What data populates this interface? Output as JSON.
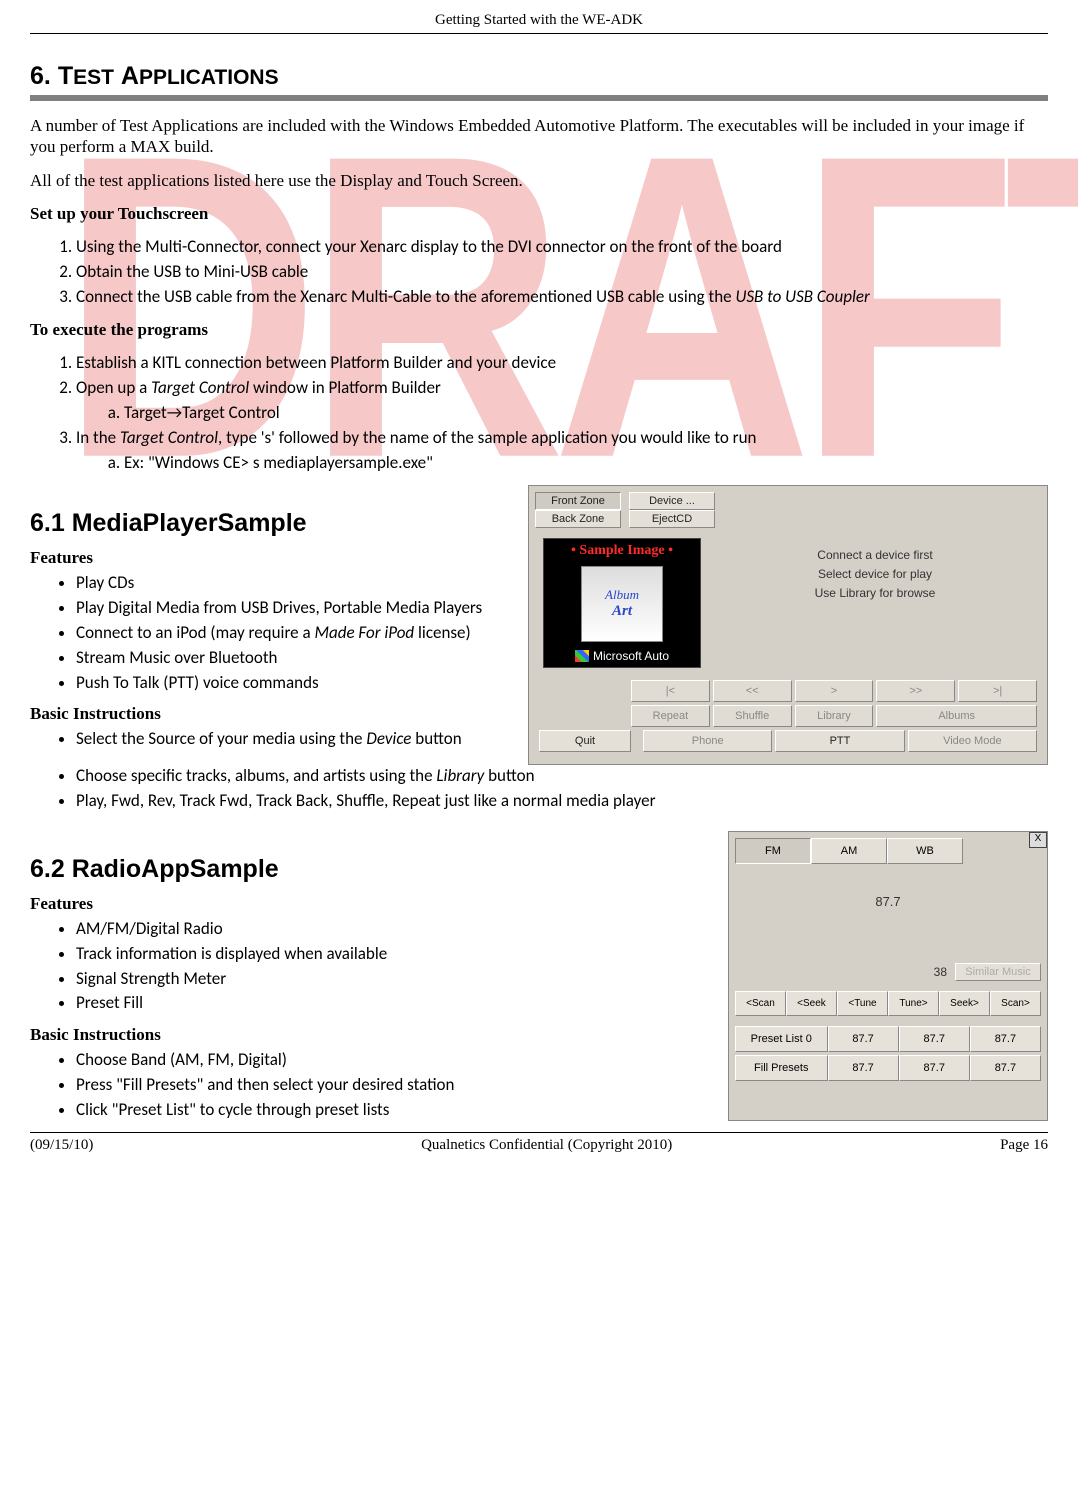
{
  "header": {
    "title": "Getting Started with the WE-ADK"
  },
  "watermark": "DRAFT",
  "section": {
    "number": "6.",
    "title": "TEST APPLICATIONS",
    "intro_p1": "A number of Test Applications are included with the Windows Embedded Automotive Platform.  The executables will be included in your image if you perform a MAX build.",
    "intro_p2": "All of the test applications listed here use the Display and Touch Screen.",
    "setup_heading": "Set up your Touchscreen",
    "setup_items": [
      "Using the Multi-Connector, connect your Xenarc display to the DVI connector on the front of the board",
      "Obtain the USB to Mini-USB cable",
      {
        "text_pre": "Connect the USB cable from the Xenarc Multi-Cable to the aforementioned USB cable using the ",
        "italic": "USB to USB Coupler"
      }
    ],
    "exec_heading": "To execute the programs",
    "exec_items": [
      {
        "text": "Establish a KITL connection between Platform Builder and your device"
      },
      {
        "text_pre": "Open up a ",
        "italic": "Target Control",
        "text_post": " window in Platform Builder",
        "sub": [
          "Target→Target Control"
        ]
      },
      {
        "text_pre": "In the ",
        "italic": "Target Control",
        "text_post": ", type 's' followed by the name of the sample application you would like to run",
        "sub": [
          "Ex:  \"Windows CE> s mediaplayersample.exe\""
        ]
      }
    ]
  },
  "s61": {
    "heading": "6.1  MediaPlayerSample",
    "features_h": "Features",
    "features": [
      "Play CDs",
      "Play Digital Media from USB Drives, Portable Media Players",
      {
        "text_pre": "Connect to an iPod (may require a ",
        "italic": "Made For iPod",
        "text_post": " license)"
      },
      "Stream Music over Bluetooth",
      "Push To Talk (PTT) voice commands"
    ],
    "basic_h": "Basic Instructions",
    "basic": [
      {
        "text_pre": "Select the Source of your media using the ",
        "italic": "Device",
        "text_post": " button"
      },
      {
        "text_pre": "Choose specific tracks, albums, and artists using the ",
        "italic": "Library",
        "text_post": " button"
      },
      "Play, Fwd, Rev, Track Fwd, Track Back, Shuffle, Repeat just like a normal media player"
    ],
    "figure": {
      "front_zone": "Front Zone",
      "back_zone": "Back Zone",
      "device": "Device ...",
      "eject": "EjectCD",
      "sample_image": "• Sample Image •",
      "album_l1": "Album",
      "album_l2": "Art",
      "brand": "Microsoft Auto",
      "info_l1": "Connect a device first",
      "info_l2": "Select device for play",
      "info_l3": "Use Library for browse",
      "row1": [
        "|<",
        "<<",
        ">",
        ">>",
        ">|"
      ],
      "row2": [
        "Repeat",
        "Shuffle",
        "Library",
        "Albums"
      ],
      "quit": "Quit",
      "row3": [
        "Phone",
        "PTT",
        "Video Mode"
      ]
    }
  },
  "s62": {
    "heading": "6.2  RadioAppSample",
    "features_h": "Features",
    "features": [
      "AM/FM/Digital Radio",
      "Track information is displayed when available",
      "Signal Strength Meter",
      "Preset Fill"
    ],
    "basic_h": "Basic Instructions",
    "basic": [
      "Choose Band (AM, FM, Digital)",
      "Press \"Fill Presets\" and then select your desired station",
      "Click \"Preset List\" to cycle through preset lists"
    ],
    "figure": {
      "close": "X",
      "tabs": [
        "FM",
        "AM",
        "WB"
      ],
      "freq": "87.7",
      "mid_num": "38",
      "similar": "Similar Music",
      "ctrl": [
        "<Scan",
        "<Seek",
        "<Tune",
        "Tune>",
        "Seek>",
        "Scan>"
      ],
      "preset_rows": [
        [
          "Preset List 0",
          "87.7",
          "87.7",
          "87.7"
        ],
        [
          "Fill Presets",
          "87.7",
          "87.7",
          "87.7"
        ]
      ]
    }
  },
  "footer": {
    "date": "(09/15/10)",
    "center": "Qualnetics Confidential (Copyright 2010)",
    "page": "Page 16"
  }
}
